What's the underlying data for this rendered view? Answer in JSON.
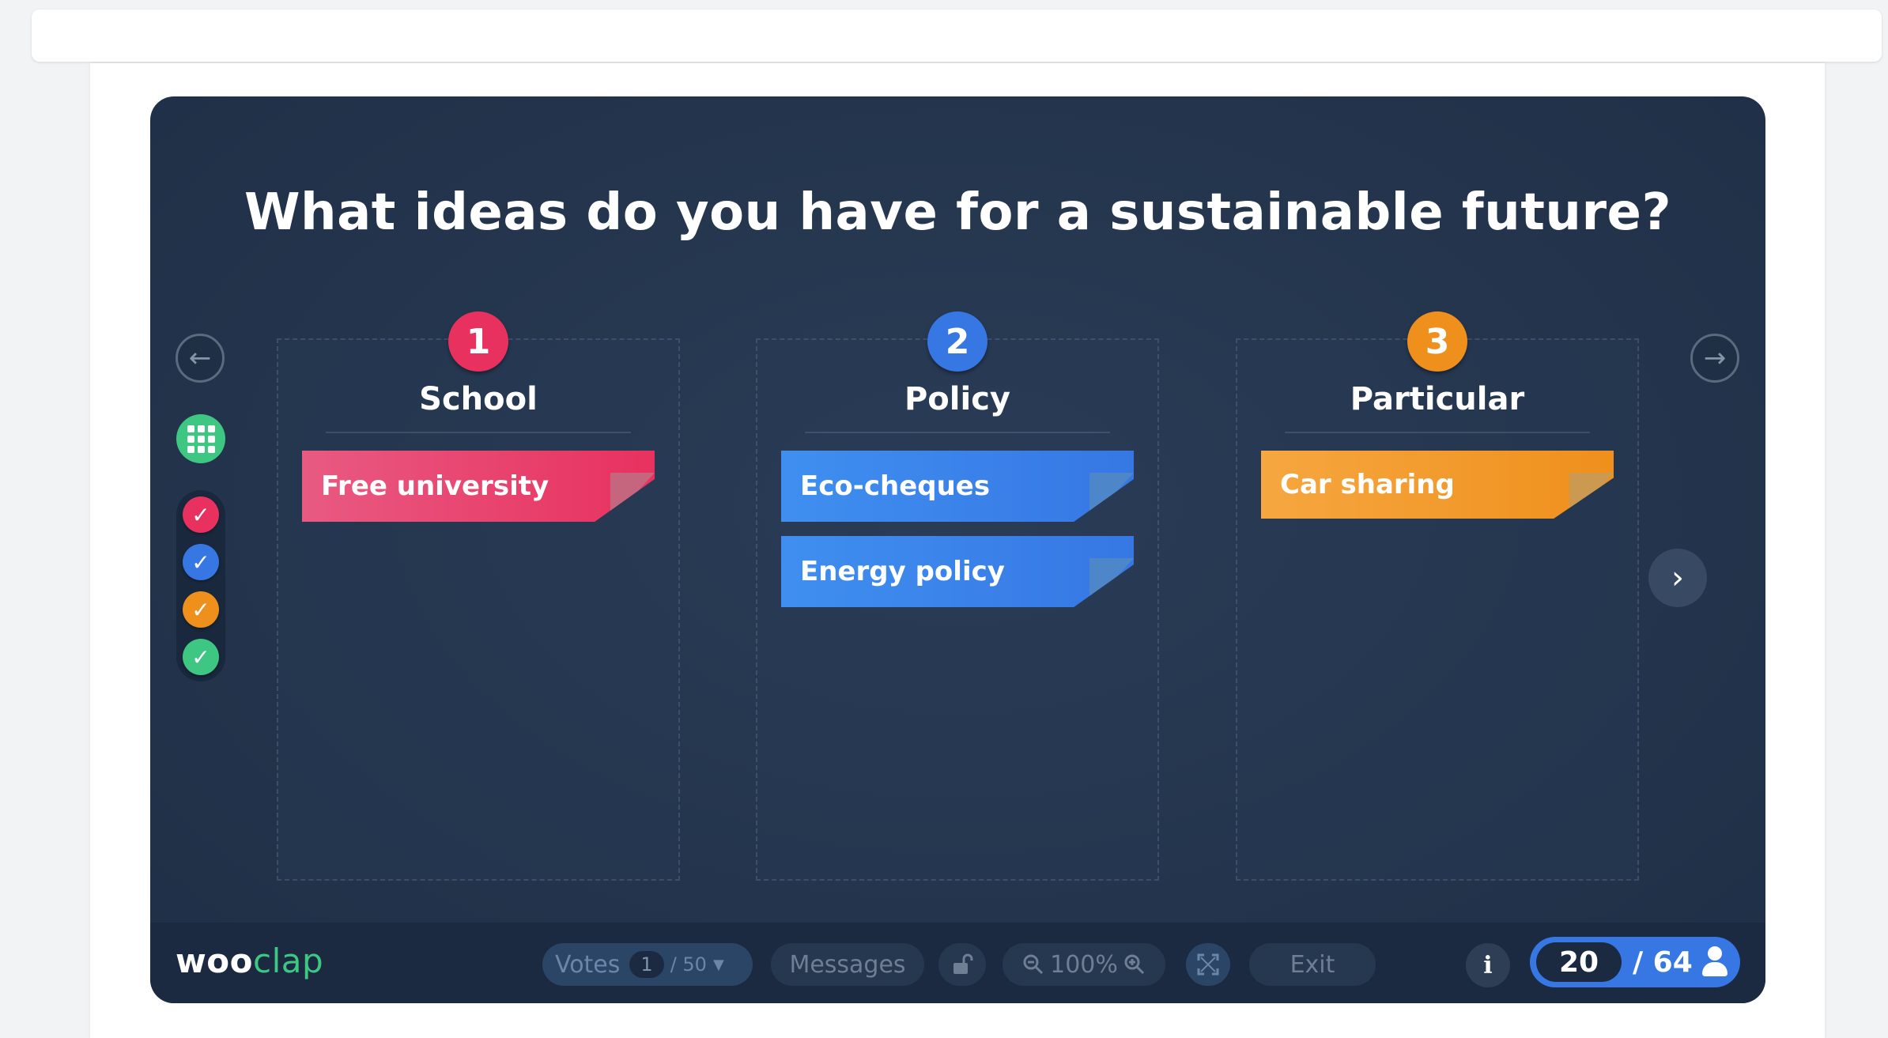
{
  "slide": {
    "question": "What ideas do you have for a sustainable future?"
  },
  "navigation": {
    "prev_icon": "arrow-left-icon",
    "next_icon": "arrow-right-icon",
    "grid_icon": "grid-icon",
    "next_page_glyph": "›"
  },
  "filters": {
    "checks": [
      {
        "color": "#e8315f"
      },
      {
        "color": "#3677e4"
      },
      {
        "color": "#ef8f1c"
      },
      {
        "color": "#3ec783"
      }
    ],
    "check_glyph": "✓"
  },
  "columns": [
    {
      "number": "1",
      "title": "School",
      "color": "#e8315f",
      "items": [
        "Free university"
      ]
    },
    {
      "number": "2",
      "title": "Policy",
      "color": "#3677e4",
      "items": [
        "Eco-cheques",
        "Energy policy"
      ]
    },
    {
      "number": "3",
      "title": "Particular",
      "color": "#ef8f1c",
      "items": [
        "Car sharing"
      ]
    }
  ],
  "toolbar": {
    "logo_woo": "woo",
    "logo_clap": "clap",
    "votes_label": "Votes",
    "votes_count": "1",
    "votes_total": "/ 50",
    "messages_label": "Messages",
    "lock_icon": "unlock-icon",
    "zoom_level": "100%",
    "exit_label": "Exit",
    "info_label": "i",
    "participants_current": "20",
    "participants_total": "/ 64"
  }
}
